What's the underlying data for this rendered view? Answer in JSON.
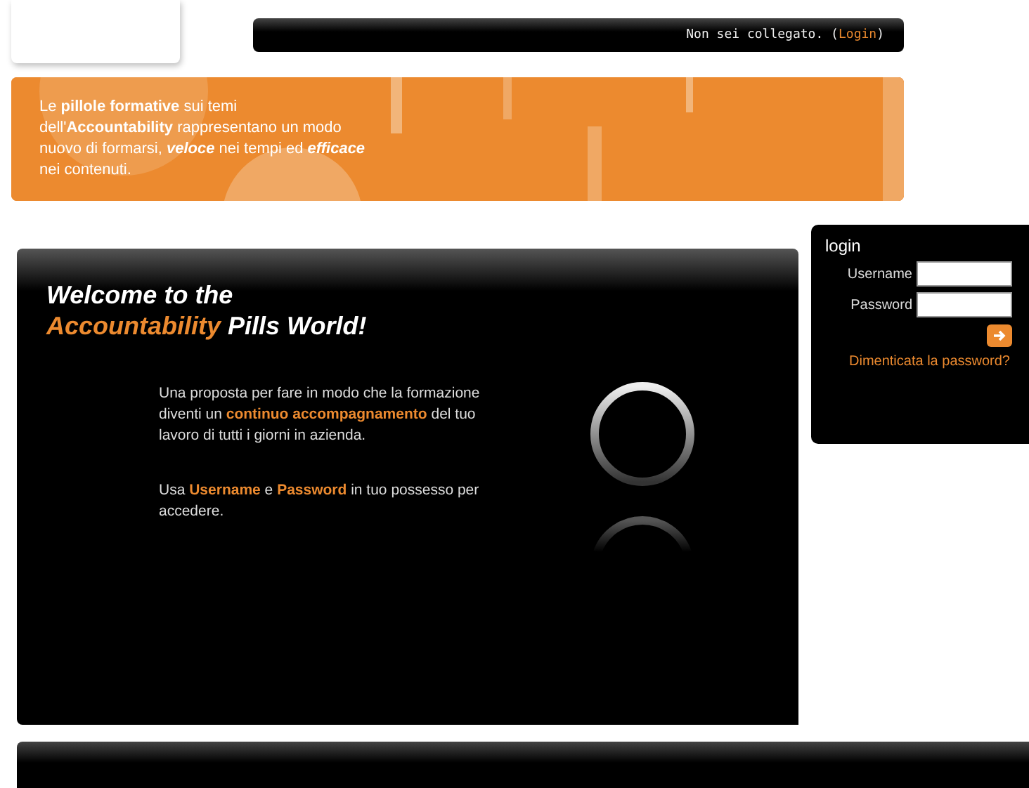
{
  "status_bar": {
    "text": "Non sei collegato. (",
    "link": "Login",
    "suffix": ")"
  },
  "banner": {
    "segments": [
      {
        "text": "Le ",
        "bold": false,
        "italic": false
      },
      {
        "text": "pillole formative",
        "bold": true,
        "italic": false
      },
      {
        "text": " sui temi dell'",
        "bold": false,
        "italic": false
      },
      {
        "text": "Accountability",
        "bold": true,
        "italic": false
      },
      {
        "text": " rappresentano un modo nuovo di formarsi, ",
        "bold": false,
        "italic": false
      },
      {
        "text": "veloce",
        "bold": true,
        "italic": true
      },
      {
        "text": " nei tempi ed ",
        "bold": false,
        "italic": false
      },
      {
        "text": "efficace",
        "bold": true,
        "italic": true
      },
      {
        "text": " nei contenuti.",
        "bold": false,
        "italic": false
      }
    ]
  },
  "welcome": {
    "title_lines": [
      [
        {
          "text": "Welcome to the",
          "accent": false
        }
      ],
      [
        {
          "text": "Accountability",
          "accent": true
        },
        {
          "text": " Pills World!",
          "accent": false
        }
      ]
    ],
    "paragraphs": [
      [
        {
          "text": "Una proposta per fare in modo che la formazione diventi un ",
          "accent": false
        },
        {
          "text": "continuo accompagnamento",
          "accent": true
        },
        {
          "text": " del tuo lavoro di tutti i giorni in azienda.",
          "accent": false
        }
      ],
      [
        {
          "text": "Usa ",
          "accent": false
        },
        {
          "text": "Username",
          "accent": true
        },
        {
          "text": " e ",
          "accent": false
        },
        {
          "text": "Password",
          "accent": true
        },
        {
          "text": " in tuo possesso per accedere.",
          "accent": false
        }
      ]
    ]
  },
  "login": {
    "title": "login",
    "fields": [
      {
        "label": "Username"
      },
      {
        "label": "Password"
      }
    ],
    "forgot": "Dimenticata la password?"
  }
}
